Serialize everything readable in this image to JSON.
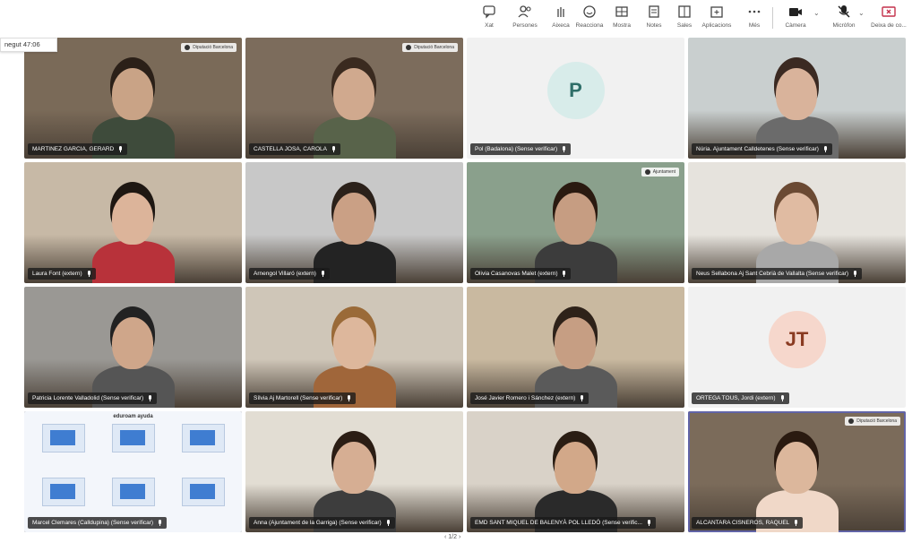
{
  "toolbar": {
    "items": [
      {
        "label": "Xat",
        "icon": "chat-icon"
      },
      {
        "label": "Persones",
        "icon": "people-icon"
      },
      {
        "label": "Aixeca",
        "icon": "raise-hand-icon"
      },
      {
        "label": "Reacciona",
        "icon": "react-icon"
      },
      {
        "label": "Mostra",
        "icon": "view-icon"
      },
      {
        "label": "Notes",
        "icon": "notes-icon"
      },
      {
        "label": "Sales",
        "icon": "rooms-icon"
      },
      {
        "label": "Aplicacions",
        "icon": "apps-icon"
      },
      {
        "label": "Més",
        "icon": "more-icon"
      },
      {
        "label": "Càmera",
        "icon": "camera-icon"
      },
      {
        "label": "Micròfon",
        "icon": "microphone-icon"
      },
      {
        "label": "Deixa de co...",
        "icon": "share-icon"
      }
    ]
  },
  "timer": "negut 47:06",
  "tiles": [
    {
      "name": "MARTINEZ GARCIA, GERARD",
      "type": "video",
      "bg": "#7a6a58",
      "badge": "Diputació Barcelona",
      "skin": "#c9a386",
      "shirt": "#3e4b3b",
      "hair": "#2b2018"
    },
    {
      "name": "CASTELLA JOSA, CAROLA",
      "type": "video",
      "bg": "#7c6c5c",
      "badge": "Diputació Barcelona",
      "skin": "#d0a98e",
      "shirt": "#58634a",
      "hair": "#3a2a1f"
    },
    {
      "name": "Pol (Badalona) (Sense verificar)",
      "type": "avatar",
      "initials": "P"
    },
    {
      "name": "Núria. Ajuntament Calldetenes (Sense verificar)",
      "type": "video",
      "bg": "#c9cfcf",
      "skin": "#d9b39b",
      "shirt": "#6b6b6b",
      "hair": "#3b2a22"
    },
    {
      "name": "Laura Font (extern)",
      "type": "video",
      "bg": "#c7b9a6",
      "skin": "#dcb49a",
      "shirt": "#b8323a",
      "hair": "#1e1712"
    },
    {
      "name": "Arnengol Villaró (extern)",
      "type": "video",
      "bg": "#c8c8c8",
      "skin": "#caa085",
      "shirt": "#232323",
      "hair": "#2b211a"
    },
    {
      "name": "Olivia Casanovas Malet (extern)",
      "type": "video",
      "bg": "#8aa08c",
      "badge": "Ajuntament",
      "skin": "#c69d82",
      "shirt": "#3c3c3c",
      "hair": "#2a1a10"
    },
    {
      "name": "Neus Sellabona Aj Sant Cebrià de Vallalta (Sense verificar)",
      "type": "video",
      "bg": "#e6e3dd",
      "skin": "#e0bba2",
      "shirt": "#a8a8a8",
      "hair": "#6b4a33"
    },
    {
      "name": "Patricia Lorente Valladolid (Sense verificar)",
      "type": "video",
      "bg": "#9a9894",
      "skin": "#cfa68a",
      "shirt": "#555",
      "hair": "#222"
    },
    {
      "name": "Sílvia Aj Martorell (Sense verificar)",
      "type": "video",
      "bg": "#cfc6b8",
      "skin": "#ddb79c",
      "shirt": "#a0663a",
      "hair": "#9a6a38"
    },
    {
      "name": "José Javier Romero i Sánchez (extern)",
      "type": "video",
      "bg": "#c9b9a0",
      "skin": "#c69e83",
      "shirt": "#5a5a5a",
      "hair": "#2e2219"
    },
    {
      "name": "ORTEGA TOUS, Jordi (extern)",
      "type": "avatar",
      "initials": "JT"
    },
    {
      "name": "Marcel Clemares (Calldupina) (Sense verificar)",
      "type": "shared",
      "title": "eduroam ayuda"
    },
    {
      "name": "Anna (Ajuntament de la Garriga) (Sense verificar)",
      "type": "video",
      "bg": "#e2ddd3",
      "skin": "#d6ae93",
      "shirt": "#3d3d3d",
      "hair": "#2b1d14"
    },
    {
      "name": "EMD SANT MIQUEL DE BALENYÀ POL LLEDÓ (Sense verific...",
      "type": "video",
      "bg": "#d9d2c8",
      "skin": "#d2a889",
      "shirt": "#2a2a2a",
      "hair": "#2a1d13"
    },
    {
      "name": "ALCANTARA CISNEROS, RAQUEL",
      "type": "video",
      "bg": "#7b6b5a",
      "badge": "Diputació Barcelona",
      "skin": "#dcb79c",
      "shirt": "#f0d8c8",
      "hair": "#2a1a10",
      "active": true
    }
  ],
  "pager": "‹ 1/2 ›"
}
